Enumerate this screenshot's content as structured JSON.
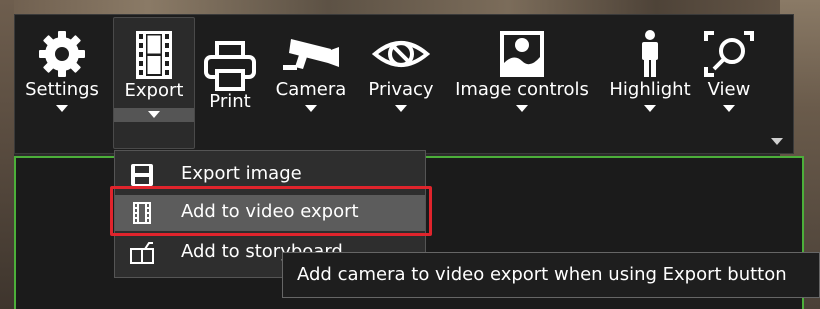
{
  "toolbar": {
    "items": [
      {
        "label": "Settings",
        "icon": "gear-icon"
      },
      {
        "label": "Export",
        "icon": "film-strip-icon"
      },
      {
        "label": "Print",
        "icon": "printer-icon"
      },
      {
        "label": "Camera",
        "icon": "security-camera-icon"
      },
      {
        "label": "Privacy",
        "icon": "eye-crossed-icon"
      },
      {
        "label": "Image controls",
        "icon": "image-icon"
      },
      {
        "label": "Highlight",
        "icon": "person-icon"
      },
      {
        "label": "View",
        "icon": "magnifier-icon"
      }
    ],
    "active": "Export"
  },
  "export_menu": {
    "items": [
      {
        "label": "Export image",
        "icon": "save-icon"
      },
      {
        "label": "Add to video export",
        "icon": "film-strip-icon"
      },
      {
        "label": "Add to storyboard",
        "icon": "storyboard-icon"
      }
    ],
    "highlighted": "Add to video export"
  },
  "tooltip": {
    "text": "Add camera to video export when using Export button"
  },
  "colors": {
    "highlight_border": "#e0242c",
    "viewport_border": "#4caf3a",
    "toolbar_bg": "#1d1d1d"
  }
}
